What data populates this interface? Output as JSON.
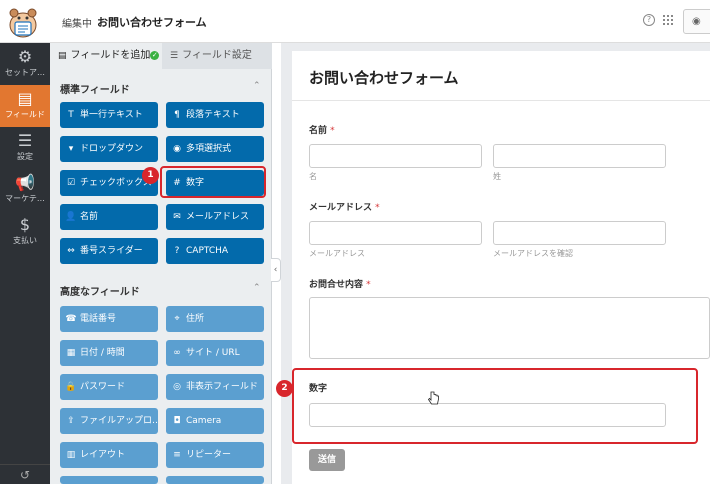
{
  "header": {
    "title_prefix": "編集中",
    "title": "お問い合わせフォーム",
    "help_icon": "?",
    "preview_icon": "eye-icon"
  },
  "leftnav": {
    "items": [
      {
        "label": "セットア…",
        "icon": "gear-icon",
        "glyph": "⚙"
      },
      {
        "label": "フィールド",
        "icon": "fields-icon",
        "glyph": "▤"
      },
      {
        "label": "設定",
        "icon": "sliders-icon",
        "glyph": "☰"
      },
      {
        "label": "マーケテ…",
        "icon": "megaphone-icon",
        "glyph": "📢"
      },
      {
        "label": "支払い",
        "icon": "dollar-icon",
        "glyph": "$"
      }
    ],
    "bottom_glyph": "↺",
    "active_color": "#e27730"
  },
  "panel": {
    "tabs": {
      "add_fields": "フィールドを追加",
      "field_settings": "フィールド設定"
    },
    "standard": {
      "title": "標準フィールド",
      "fields": [
        {
          "label": "単一行テキスト",
          "glyph": "T"
        },
        {
          "label": "段落テキスト",
          "glyph": "¶"
        },
        {
          "label": "ドロップダウン",
          "glyph": "▾"
        },
        {
          "label": "多項選択式",
          "glyph": "◉"
        },
        {
          "label": "チェックボックス",
          "glyph": "☑"
        },
        {
          "label": "数字",
          "glyph": "#"
        },
        {
          "label": "名前",
          "glyph": "👤"
        },
        {
          "label": "メールアドレス",
          "glyph": "✉"
        },
        {
          "label": "番号スライダー",
          "glyph": "⇔"
        },
        {
          "label": "CAPTCHA",
          "glyph": "?"
        }
      ]
    },
    "advanced": {
      "title": "高度なフィールド",
      "fields": [
        {
          "label": "電話番号",
          "glyph": "☎"
        },
        {
          "label": "住所",
          "glyph": "⌖"
        },
        {
          "label": "日付 / 時間",
          "glyph": "▦"
        },
        {
          "label": "サイト / URL",
          "glyph": "∞"
        },
        {
          "label": "パスワード",
          "glyph": "🔒"
        },
        {
          "label": "非表示フィールド",
          "glyph": "◎"
        },
        {
          "label": "ファイルアップロ…",
          "glyph": "⇪"
        },
        {
          "label": "Camera",
          "glyph": "◘"
        },
        {
          "label": "レイアウト",
          "glyph": "▥"
        },
        {
          "label": "リピーター",
          "glyph": "≡"
        }
      ]
    },
    "standard_color": "#036aab",
    "advanced_color": "#5b9fd0"
  },
  "form": {
    "title": "お問い合わせフォーム",
    "name_label": "名前",
    "required_mark": "*",
    "first_sublabel": "名",
    "last_sublabel": "姓",
    "email_label": "メールアドレス",
    "email_sublabel": "メールアドレス",
    "email_confirm_sublabel": "メールアドレスを確認",
    "message_label": "お問合せ内容",
    "number_label": "数字",
    "submit": "送信"
  },
  "callouts": {
    "step1": "1",
    "step2": "2",
    "color": "#d8262c"
  }
}
